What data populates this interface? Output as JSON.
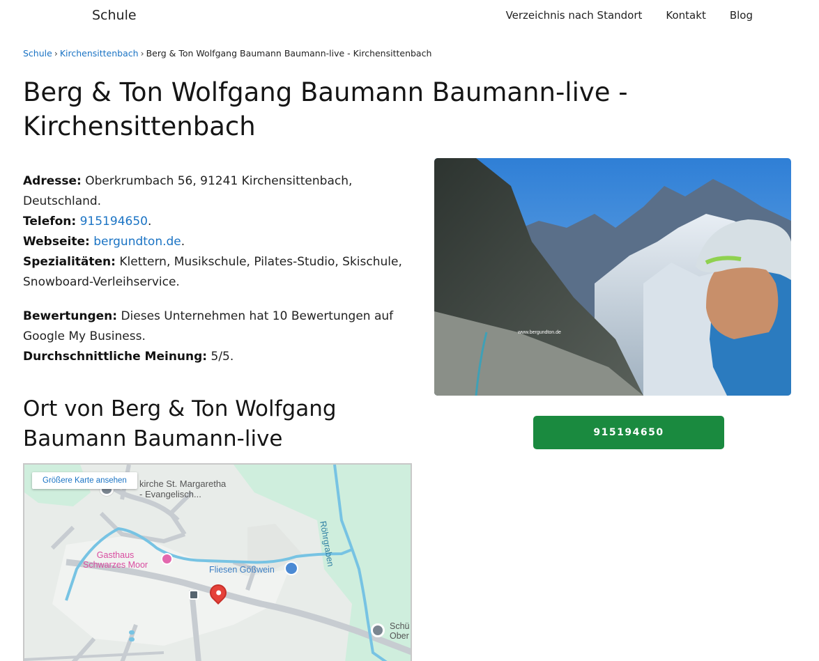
{
  "header": {
    "brand": "Schule",
    "nav": [
      "Verzeichnis nach Standort",
      "Kontakt",
      "Blog"
    ]
  },
  "breadcrumb": {
    "items": [
      "Schule",
      "Kirchensittenbach"
    ],
    "current": "Berg & Ton Wolfgang Baumann Baumann-live - Kirchensittenbach",
    "separator": "›"
  },
  "title": "Berg & Ton Wolfgang Baumann Baumann-live - Kirchensittenbach",
  "info": {
    "address_label": "Adresse:",
    "address_value": "Oberkrumbach 56, 91241 Kirchensittenbach, Deutschland.",
    "phone_label": "Telefon:",
    "phone_value": "915194650",
    "website_label": "Webseite:",
    "website_value": "bergundton.de",
    "specialties_label": "Spezialitäten:",
    "specialties_value": "Klettern, Musikschule, Pilates-Studio, Skischule, Snowboard-Verleihservice.",
    "reviews_label": "Bewertungen:",
    "reviews_value": "Dieses Unternehmen hat 10 Bewertungen auf Google My Business.",
    "rating_label": "Durchschnittliche Meinung:",
    "rating_value": "5/5."
  },
  "location_title": "Ort von Berg & Ton Wolfgang Baumann Baumann-live",
  "map": {
    "button": "Größere Karte ansehen",
    "labels": {
      "church_line1": "kirche St. Margaretha",
      "church_line2": "- Evangelisch...",
      "river": "Röhrgraben",
      "gasthaus_line1": "Gasthaus",
      "gasthaus_line2": "Schwarzes Moor",
      "shop": "Fliesen Gößwein",
      "school_line1": "Schü",
      "school_line2": "Ober"
    }
  },
  "photo": {
    "watermark": "www.bergundton.de"
  },
  "call_button": "915194650",
  "colors": {
    "link": "#1a73c4",
    "call_button": "#1a8a3f"
  }
}
